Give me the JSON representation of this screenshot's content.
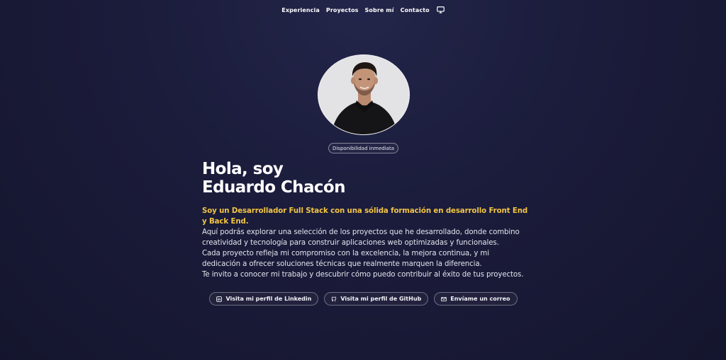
{
  "nav": {
    "items": [
      {
        "label": "Experiencia"
      },
      {
        "label": "Proyectos"
      },
      {
        "label": "Sobre mí"
      },
      {
        "label": "Contacto"
      }
    ],
    "theme_icon": "monitor-icon"
  },
  "profile": {
    "avatar_icon": "profile-photo",
    "badge": "Disponibilidad inmediata"
  },
  "hero": {
    "title_line1": "Hola, soy",
    "title_line2": "Eduardo Chacón"
  },
  "bio": {
    "highlight": "Soy un Desarrollador Full Stack con una sólida formación en desarrollo Front End y Back End.",
    "paragraph1": "Aquí podrás explorar una selección de los proyectos que he desarrollado, donde combino creatividad y tecnología para construir aplicaciones web optimizadas y funcionales.",
    "paragraph2": "Cada proyecto refleja mi compromiso con la excelencia, la mejora continua, y mi dedicación a ofrecer soluciones técnicas que realmente marquen la diferencia.",
    "paragraph3": "Te invito a conocer mi trabajo y descubrir cómo puedo contribuir al éxito de tus proyectos."
  },
  "actions": {
    "linkedin": {
      "label": "Visita mi perfil de Linkedin",
      "icon": "linkedin-icon"
    },
    "github": {
      "label": "Visita mi perfil de GitHub",
      "icon": "github-icon"
    },
    "email": {
      "label": "Envíame un correo",
      "icon": "mail-icon"
    }
  },
  "colors": {
    "background": "#1b1c3b",
    "accent": "#f3c544",
    "text": "#e3e4ee"
  }
}
